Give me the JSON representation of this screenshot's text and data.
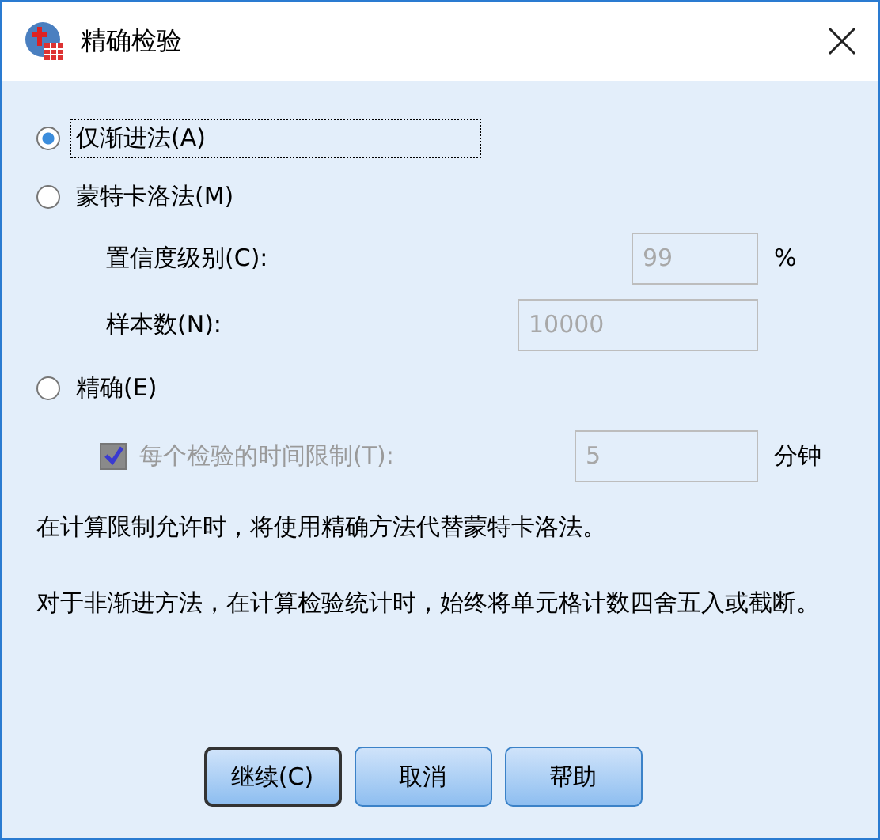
{
  "window": {
    "title": "精确检验"
  },
  "options": [
    {
      "kind": "radio",
      "label": "仅渐进法(A)",
      "selected": true,
      "focused": true
    },
    {
      "kind": "radio",
      "label": "蒙特卡洛法(M)",
      "selected": false,
      "focused": false
    },
    {
      "kind": "field",
      "label": "置信度级别(C):",
      "value": "99",
      "unit": "%",
      "disabled": true
    },
    {
      "kind": "field",
      "label": "样本数(N):",
      "value": "10000",
      "disabled": true
    },
    {
      "kind": "radio",
      "label": "精确(E)",
      "selected": false,
      "focused": false
    },
    {
      "kind": "check",
      "label": "每个检验的时间限制(T):",
      "checked": true,
      "disabled": true,
      "value": "5",
      "unit": "分钟"
    }
  ],
  "notes": [
    "在计算限制允许时，将使用精确方法代替蒙特卡洛法。",
    "对于非渐进方法，在计算检验统计时，始终将单元格计数四舍五入或截断。"
  ],
  "buttons": [
    {
      "label": "继续(C)",
      "default": true
    },
    {
      "label": "取消",
      "default": false
    },
    {
      "label": "帮助",
      "default": false
    }
  ]
}
